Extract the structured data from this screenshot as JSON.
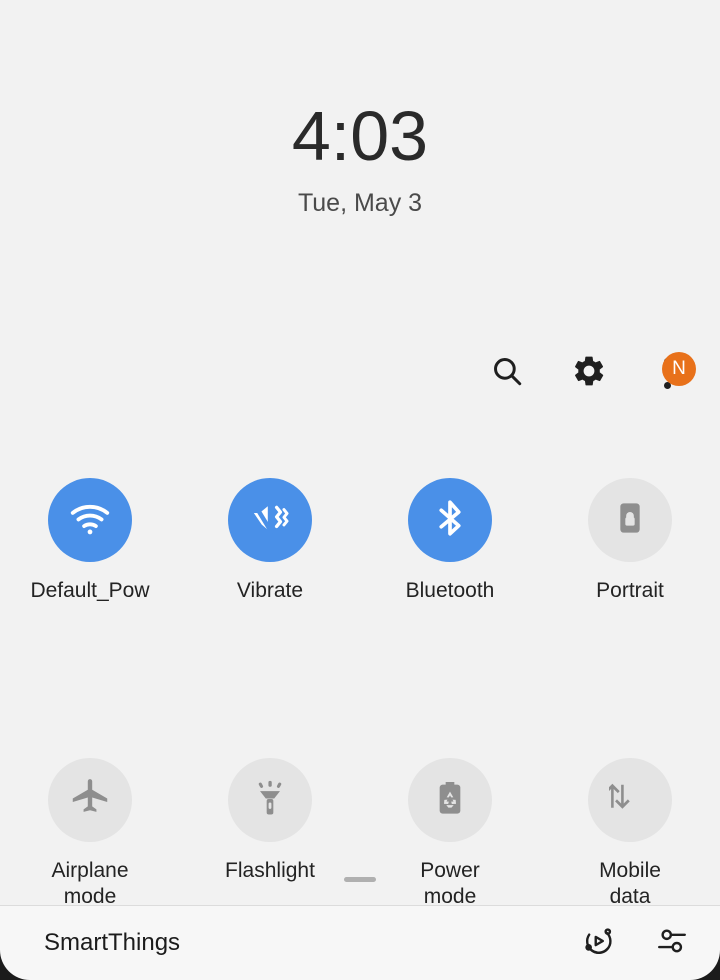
{
  "status": {
    "time": "4:03",
    "date": "Tue, May 3"
  },
  "header": {
    "search_icon": "search-icon",
    "settings_icon": "gear-icon",
    "more_icon": "more-vertical-icon",
    "badge_label": "N",
    "badge_color": "#e8711a"
  },
  "colors": {
    "page_background": "#f2f2f2",
    "tile_active": "#4a90e8",
    "tile_inactive": "#e4e4e4",
    "icon_active": "#ffffff",
    "icon_inactive": "#8e8e8e",
    "text_primary": "#232323",
    "bottom_bar_background": "#f7f7f7"
  },
  "tiles": [
    {
      "label": "Default_Pow",
      "icon": "wifi-icon",
      "state": "on"
    },
    {
      "label": "Vibrate",
      "icon": "vibrate-icon",
      "state": "on"
    },
    {
      "label": "Bluetooth",
      "icon": "bluetooth-icon",
      "state": "on"
    },
    {
      "label": "Portrait",
      "icon": "rotation-lock-icon",
      "state": "off"
    },
    {
      "label": "Airplane\nmode",
      "icon": "airplane-icon",
      "state": "off"
    },
    {
      "label": "Flashlight",
      "icon": "flashlight-icon",
      "state": "off"
    },
    {
      "label": "Power\nmode",
      "icon": "battery-eco-icon",
      "state": "off"
    },
    {
      "label": "Mobile\ndata",
      "icon": "mobile-data-icon",
      "state": "off"
    }
  ],
  "bottom_bar": {
    "title": "SmartThings",
    "media_icon": "media-output-icon",
    "controls_icon": "sliders-icon"
  }
}
